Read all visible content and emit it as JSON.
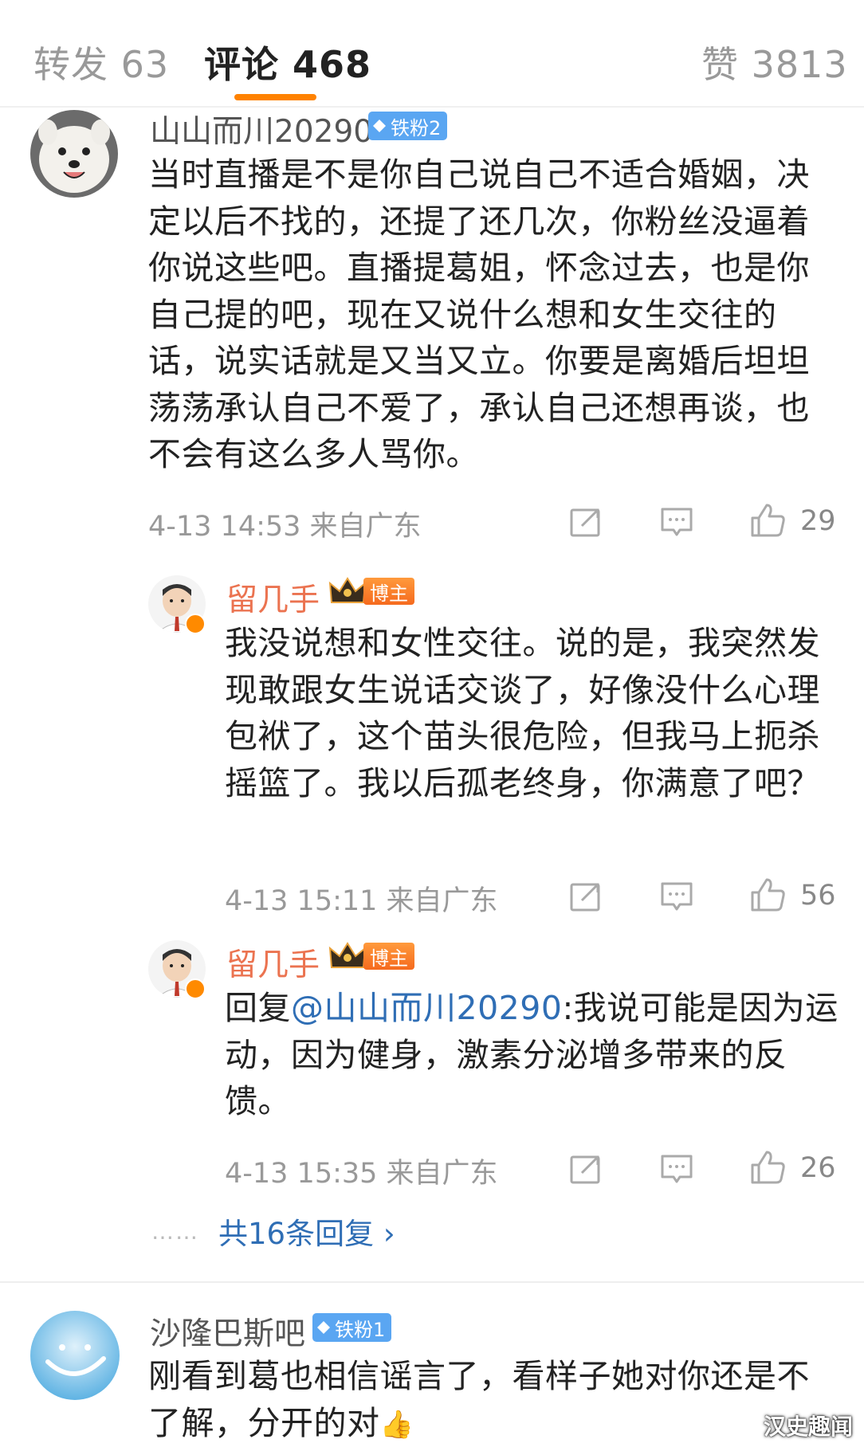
{
  "tabs": {
    "repost": "转发 63",
    "comments": "评论 468",
    "likes": "赞 3813"
  },
  "comments": [
    {
      "user": "山山而川20290",
      "badge": "铁粉2",
      "text": "当时直播是不是你自己说自己不适合婚姻，决定以后不找的，还提了还几次，你粉丝没逼着你说这些吧。直播提葛姐，怀念过去，也是你自己提的吧，现在又说什么想和女生交往的话，说实话就是又当又立。你要是离婚后坦坦荡荡承认自己不爱了，承认自己还想再谈，也不会有这么多人骂你。",
      "time": "4-13 14:53 来自广东",
      "likes": "29"
    },
    {
      "user": "留几手",
      "badge": "博主",
      "text": "我没说想和女性交往。说的是，我突然发现敢跟女生说话交谈了，好像没什么心理包袱了，这个苗头很危险，但我马上扼杀摇篮了。我以后孤老终身，你满意了吧？",
      "time": "4-13 15:11 来自广东",
      "likes": "56"
    },
    {
      "user": "留几手",
      "badge": "博主",
      "reply_prefix": "回复",
      "mention": "@山山而川20290",
      "text": ":我说可能是因为运动，因为健身，激素分泌增多带来的反馈。",
      "time": "4-13 15:35 来自广东",
      "likes": "26"
    }
  ],
  "more_replies": {
    "dots": "……",
    "label": "共16条回复 ›"
  },
  "comment2": {
    "user": "沙隆巴斯吧",
    "badge": "铁粉1",
    "text": "刚看到葛也相信谣言了，看样子她对你还是不了解，分开的对",
    "emoji": "👍"
  },
  "watermark": "汉史趣闻",
  "colors": {
    "accent": "#ff8200",
    "blogger_name": "#eb7350",
    "link": "#2f6eb5",
    "fan_badge": "#5aa6f2"
  },
  "icons": [
    "share-icon",
    "comment-icon",
    "like-icon",
    "diamond-icon",
    "crown-icon",
    "verified-icon"
  ]
}
